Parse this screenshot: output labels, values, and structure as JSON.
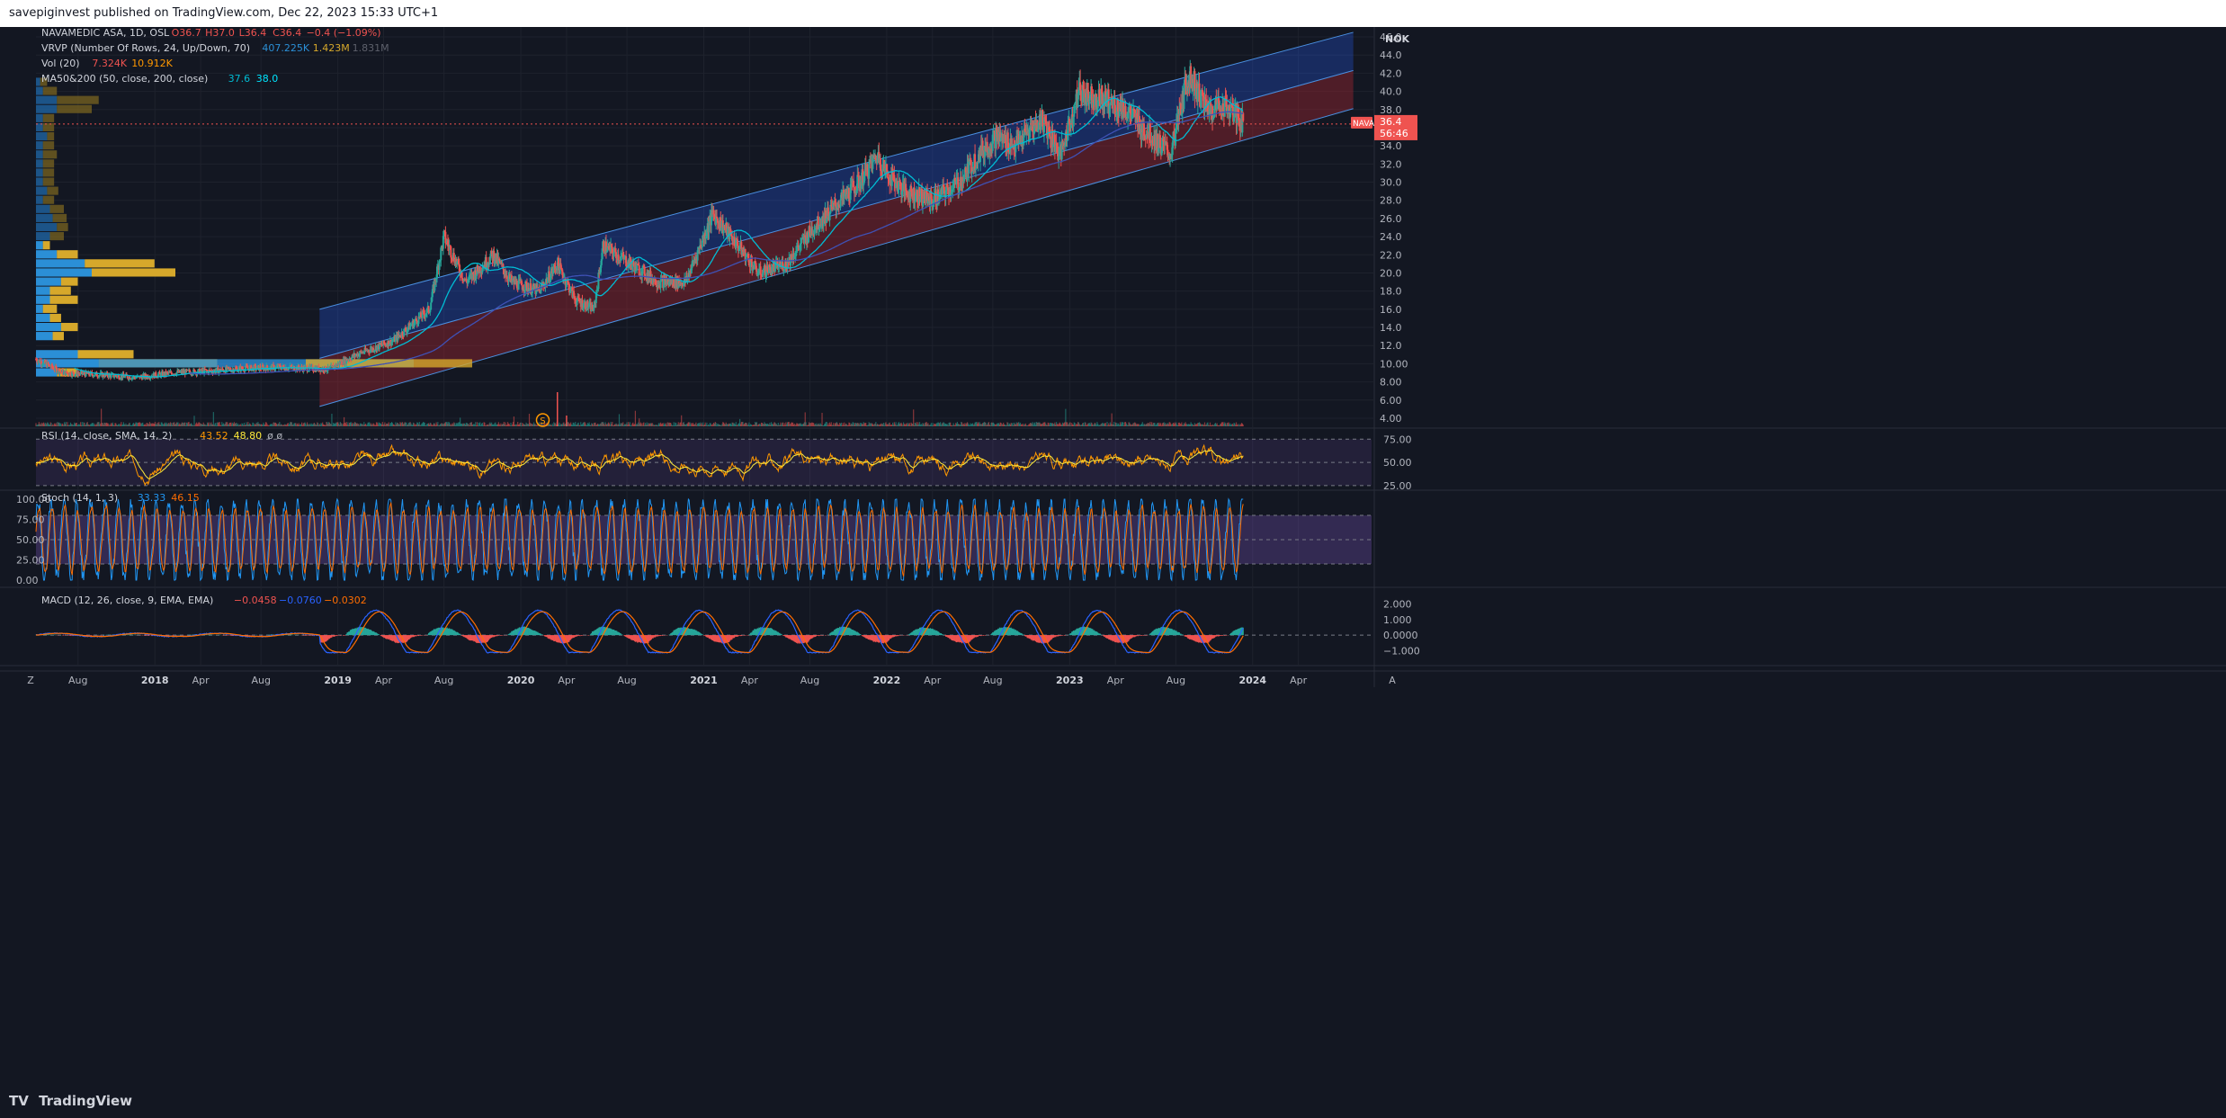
{
  "header": {
    "published": "savepiginvest published on TradingView.com, Dec 22, 2023 15:33 UTC+1"
  },
  "legend": {
    "symbol": "NAVAMEDIC ASA, 1D, OSL",
    "o": "O36.7",
    "h": "H37.0",
    "l": "L36.4",
    "c": "C36.4",
    "chg": "−0.4 (−1.09%)",
    "vrvp": "VRVP (Number Of Rows, 24, Up/Down, 70)",
    "vrvp_up": "407.225K",
    "vrvp_down": "1.423M",
    "vrvp_total": "1.831M",
    "vol": "Vol (20)",
    "vol_a": "7.324K",
    "vol_b": "10.912K",
    "ma": "MA50&200 (50, close, 200, close)",
    "ma50": "37.6",
    "ma200": "38.0",
    "rsi": "RSI (14, close, SMA, 14, 2)",
    "rsi_a": "43.52",
    "rsi_b": "48.80",
    "rsi_c": "ø ø",
    "stoch": "Stoch (14, 1, 3)",
    "stoch_k": "33.33",
    "stoch_d": "46.15",
    "macd": "MACD (12, 26, close, 9, EMA, EMA)",
    "macd_a": "−0.0458",
    "macd_b": "−0.0760",
    "macd_c": "−0.0302"
  },
  "currency": "NOK",
  "ticker_badge": "NAVA",
  "last_price": "36.4",
  "countdown": "56:46",
  "dividend_marker": "S",
  "footer": {
    "brand": "TradingView",
    "zoom": "Z",
    "auto": "A"
  },
  "colors": {
    "bg": "#131722",
    "up": "#26a69a",
    "down": "#ef5350",
    "blue_channel": "#2962ff",
    "red_channel": "#b22833",
    "ma50": "#00bcd4",
    "ma200": "#3f51b5",
    "rsi": "#ff9800",
    "stoch_k": "#2196f3",
    "stoch_d": "#ff6d00"
  },
  "chart_data": [
    {
      "type": "line",
      "title": "NAVAMEDIC ASA, 1D, OSL",
      "ylim": [
        4,
        46
      ],
      "y_ticks": [
        "46.0",
        "44.0",
        "42.0",
        "40.0",
        "38.0",
        "36.0",
        "34.0",
        "32.0",
        "30.0",
        "28.0",
        "26.0",
        "24.0",
        "22.0",
        "20.0",
        "18.0",
        "16.0",
        "14.0",
        "12.0",
        "10.00",
        "8.00",
        "6.00",
        "4.00"
      ],
      "x_ticks": [
        "Aug",
        "2018",
        "Apr",
        "Aug",
        "2019",
        "Apr",
        "Aug",
        "2020",
        "Apr",
        "Aug",
        "2021",
        "Apr",
        "Aug",
        "2022",
        "Apr",
        "Aug",
        "2023",
        "Apr",
        "Aug",
        "2024",
        "Apr"
      ],
      "price_series": {
        "name": "NAVA",
        "x": [
          2017.35,
          2017.5,
          2017.7,
          2017.9,
          2018.1,
          2018.3,
          2018.5,
          2018.7,
          2018.95,
          2019.1,
          2019.3,
          2019.5,
          2019.58,
          2019.7,
          2019.85,
          2019.95,
          2020.1,
          2020.2,
          2020.3,
          2020.4,
          2020.45,
          2020.6,
          2020.75,
          2020.9,
          2021.05,
          2021.15,
          2021.3,
          2021.45,
          2021.6,
          2021.7,
          2021.85,
          2021.95,
          2022.0,
          2022.1,
          2022.25,
          2022.4,
          2022.5,
          2022.6,
          2022.7,
          2022.85,
          2022.95,
          2023.05,
          2023.2,
          2023.3,
          2023.45,
          2023.55,
          2023.65,
          2023.75,
          2023.85,
          2023.95
        ],
        "y": [
          10.5,
          9.0,
          8.8,
          8.5,
          9.0,
          9.2,
          9.5,
          9.6,
          9.4,
          11.0,
          12.5,
          16.0,
          24.0,
          19.0,
          22.0,
          19.0,
          18.0,
          21.0,
          17.0,
          16.0,
          23.0,
          21.0,
          19.0,
          19.0,
          26.5,
          24.0,
          20.0,
          21.0,
          25.0,
          27.0,
          30.0,
          33.0,
          31.0,
          29.0,
          28.0,
          30.0,
          33.0,
          35.0,
          34.0,
          37.0,
          33.0,
          40.0,
          39.0,
          38.0,
          35.0,
          33.0,
          42.0,
          38.0,
          38.5,
          36.4
        ]
      },
      "volume_profile": {
        "price_levels": [
          9.0,
          10.0,
          11.0,
          12.0,
          13.0,
          14.0,
          15.0,
          16.0,
          17.0,
          18.0,
          19.0,
          20.0,
          21.0,
          22.0,
          23.0,
          24.0,
          25.0,
          26.0,
          27.0,
          28.0,
          29.0,
          30.0,
          31.0,
          32.0,
          33.0,
          34.0,
          35.0,
          36.0,
          37.0,
          38.0,
          39.0,
          40.0,
          41.0
        ],
        "up_volume": [
          15,
          45,
          30,
          0,
          12,
          18,
          10,
          5,
          10,
          10,
          18,
          40,
          35,
          15,
          5,
          10,
          15,
          12,
          10,
          5,
          8,
          5,
          5,
          5,
          5,
          5,
          8,
          5,
          5,
          15,
          15,
          5,
          3
        ],
        "down_volume": [
          15,
          85,
          40,
          0,
          8,
          12,
          8,
          10,
          20,
          15,
          12,
          60,
          50,
          15,
          5,
          10,
          8,
          10,
          10,
          8,
          8,
          8,
          8,
          8,
          10,
          8,
          5,
          8,
          8,
          25,
          30,
          10,
          5
        ]
      }
    },
    {
      "type": "line",
      "title": "RSI (14, close, SMA, 14, 2)",
      "ylim": [
        20,
        85
      ],
      "levels": [
        25,
        50,
        75
      ],
      "y_ticks": [
        "75.00",
        "50.00",
        "25.00"
      ]
    },
    {
      "type": "line",
      "title": "Stoch (14, 1, 3)",
      "ylim": [
        0,
        100
      ],
      "levels": [
        20,
        50,
        80
      ],
      "y_ticks": [
        "100.00",
        "75.00",
        "50.00",
        "25.00",
        "0.00"
      ]
    },
    {
      "type": "bar",
      "title": "MACD (12, 26, close, 9, EMA, EMA)",
      "ylim": [
        -1.5,
        2.5
      ],
      "y_ticks": [
        "2.000",
        "1.000",
        "0.0000",
        "−1.000"
      ]
    }
  ]
}
